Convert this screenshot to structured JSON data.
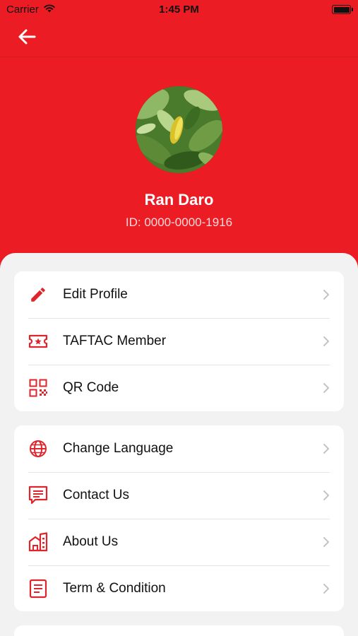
{
  "status_bar": {
    "carrier": "Carrier",
    "time": "1:45 PM",
    "wifi_icon": "wifi-icon",
    "battery_icon": "battery-icon"
  },
  "nav": {
    "back_icon": "arrow-left-icon"
  },
  "profile": {
    "name": "Ran Daro",
    "id_text": "ID: 0000-0000-1916",
    "avatar": "avatar-photo-leaves"
  },
  "colors": {
    "brand": "#ec1c24",
    "icon": "#e0242b",
    "background": "#f2f2f2",
    "card": "#ffffff",
    "chevron": "#c4c4c4"
  },
  "menu_groups": [
    {
      "items": [
        {
          "label": "Edit Profile",
          "icon": "pencil-icon"
        },
        {
          "label": "TAFTAC Member",
          "icon": "member-ticket-icon"
        },
        {
          "label": "QR Code",
          "icon": "qr-code-icon"
        }
      ]
    },
    {
      "items": [
        {
          "label": "Change Language",
          "icon": "globe-icon"
        },
        {
          "label": "Contact Us",
          "icon": "chat-icon"
        },
        {
          "label": "About Us",
          "icon": "building-icon"
        },
        {
          "label": "Term & Condition",
          "icon": "document-icon"
        }
      ]
    }
  ]
}
